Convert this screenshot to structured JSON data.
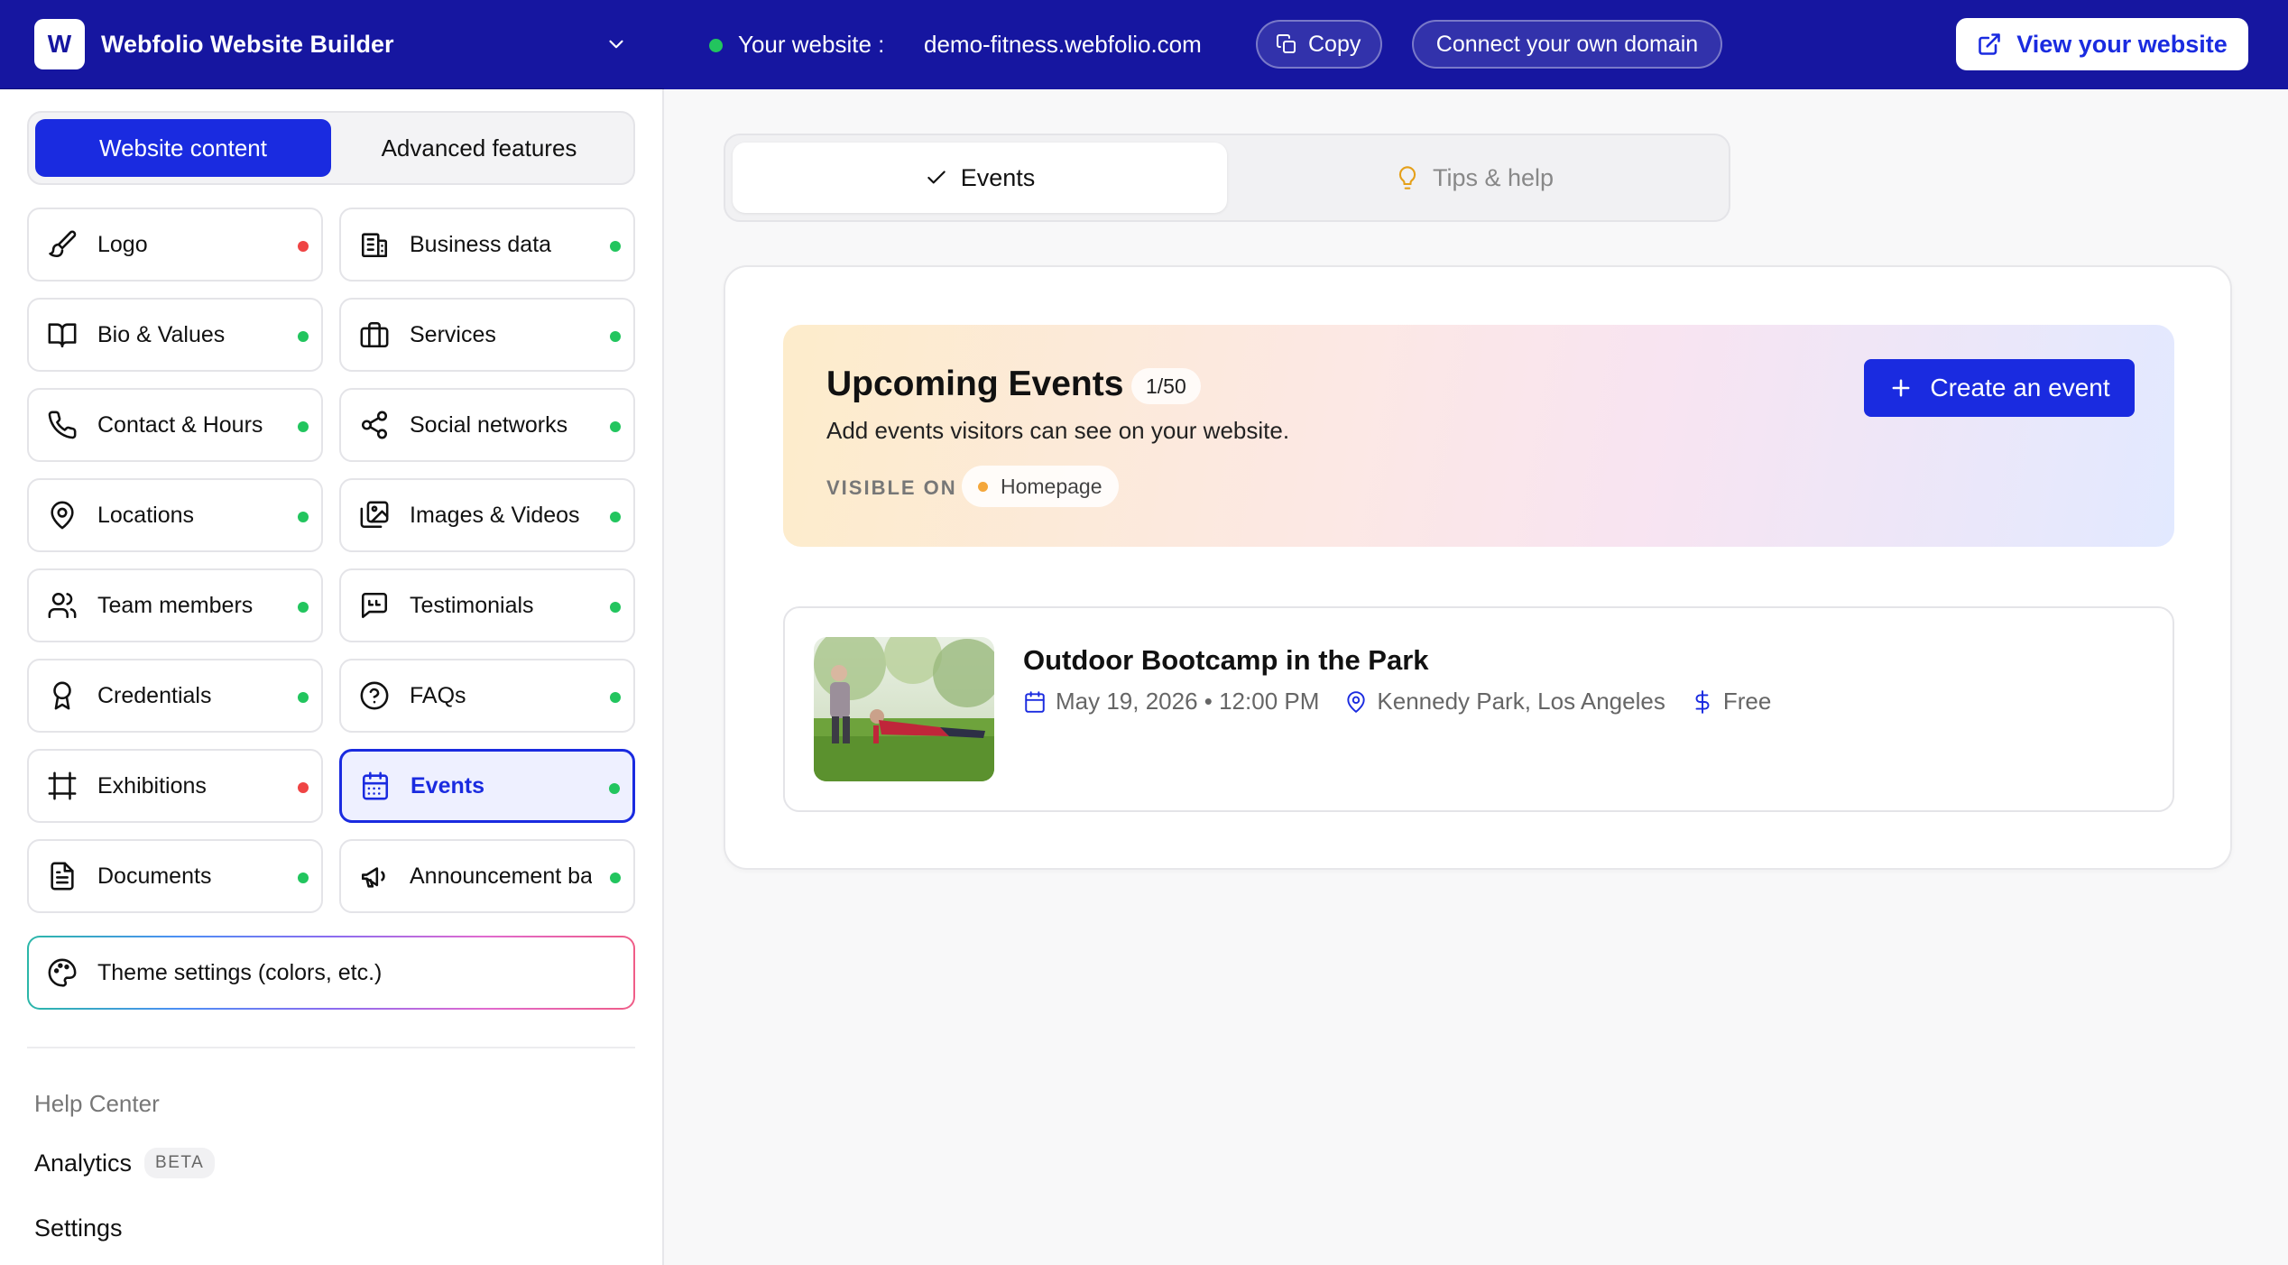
{
  "app": {
    "logo_letter": "W",
    "name": "Webfolio Website Builder"
  },
  "topbar": {
    "website_label": "Your website :",
    "website_url": "demo-fitness.webfolio.com",
    "copy_label": "Copy",
    "connect_domain_label": "Connect your own domain",
    "view_website_label": "View your website"
  },
  "sidebar": {
    "tabs": [
      {
        "label": "Website content",
        "active": true
      },
      {
        "label": "Advanced features",
        "active": false
      }
    ],
    "items": [
      {
        "label": "Logo",
        "icon": "paintbrush-icon",
        "status": "red"
      },
      {
        "label": "Business data",
        "icon": "building-icon",
        "status": "green"
      },
      {
        "label": "Bio & Values",
        "icon": "book-open-icon",
        "status": "green"
      },
      {
        "label": "Services",
        "icon": "briefcase-icon",
        "status": "green"
      },
      {
        "label": "Contact & Hours",
        "icon": "phone-icon",
        "status": "green"
      },
      {
        "label": "Social networks",
        "icon": "share-icon",
        "status": "green"
      },
      {
        "label": "Locations",
        "icon": "map-pin-icon",
        "status": "green"
      },
      {
        "label": "Images & Videos",
        "icon": "images-icon",
        "status": "green"
      },
      {
        "label": "Team members",
        "icon": "users-icon",
        "status": "green"
      },
      {
        "label": "Testimonials",
        "icon": "quote-icon",
        "status": "green"
      },
      {
        "label": "Credentials",
        "icon": "award-icon",
        "status": "green"
      },
      {
        "label": "FAQs",
        "icon": "help-circle-icon",
        "status": "green"
      },
      {
        "label": "Exhibitions",
        "icon": "frame-icon",
        "status": "red"
      },
      {
        "label": "Events",
        "icon": "calendar-icon",
        "status": "green",
        "active": true
      },
      {
        "label": "Documents",
        "icon": "file-text-icon",
        "status": "green"
      },
      {
        "label": "Announcement bar",
        "icon": "megaphone-icon",
        "status": "green"
      }
    ],
    "theme_label": "Theme settings (colors, etc.)",
    "help_center": "Help Center",
    "analytics": "Analytics",
    "analytics_badge": "BETA",
    "settings": "Settings"
  },
  "main": {
    "tabs": [
      {
        "label": "Events",
        "active": true
      },
      {
        "label": "Tips & help",
        "active": false
      }
    ],
    "hero": {
      "title": "Upcoming Events",
      "count": "1/50",
      "subtitle": "Add events visitors can see on your website.",
      "visible_on_label": "VISIBLE ON",
      "visible_on_value": "Homepage",
      "create_label": "Create an event"
    },
    "events": [
      {
        "title": "Outdoor Bootcamp in the Park",
        "date": "May 19, 2026 • 12:00 PM",
        "location": "Kennedy Park, Los Angeles",
        "price": "Free"
      }
    ]
  },
  "colors": {
    "brand_navy": "#1616a0",
    "accent_blue": "#1a2be0",
    "status_green": "#22c55e",
    "status_red": "#ef4444"
  }
}
